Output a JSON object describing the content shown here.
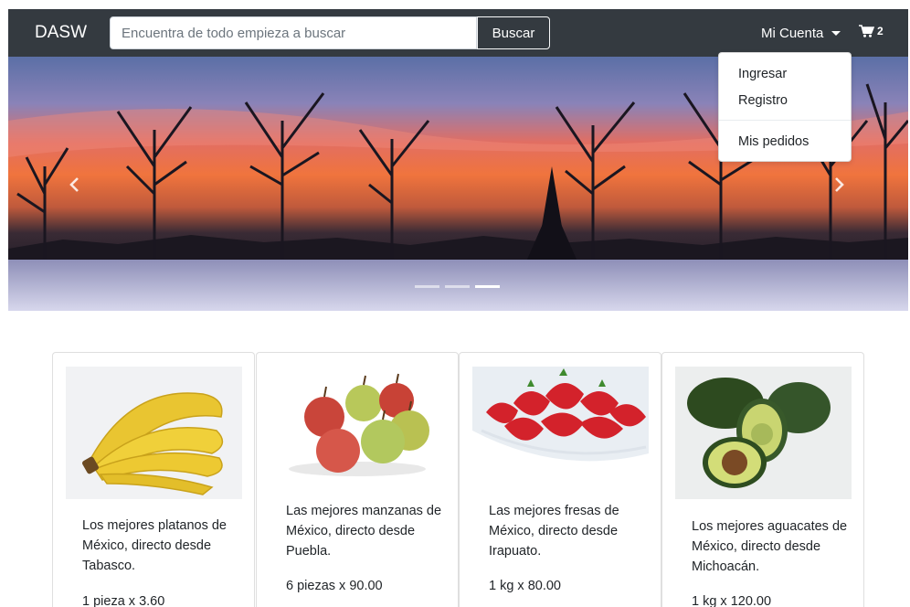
{
  "navbar": {
    "brand": "DASW",
    "search_placeholder": "Encuentra de todo empieza a buscar",
    "search_button": "Buscar",
    "account_label": "Mi Cuenta",
    "cart_count": "2"
  },
  "account_menu": {
    "items": [
      "Ingresar",
      "Registro",
      "Mis pedidos"
    ]
  },
  "carousel": {
    "slides_total": 3,
    "active_slide": 3
  },
  "products": [
    {
      "name": "platanos",
      "description": "Los mejores platanos de México, directo desde Tabasco.",
      "price": "1 pieza x 3.60"
    },
    {
      "name": "manzanas",
      "description": "Las mejores manzanas de México, directo desde Puebla.",
      "price": "6 piezas x 90.00"
    },
    {
      "name": "fresas",
      "description": "Las mejores fresas de México, directo desde Irapuato.",
      "price": "1 kg x 80.00"
    },
    {
      "name": "aguacates",
      "description": "Los mejores aguacates de México, directo desde Michoacán.",
      "price": "1 kg x 120.00"
    }
  ],
  "colors": {
    "navbar_bg": "#343a40",
    "page_bg": "#ffffff",
    "text": "#212529"
  }
}
